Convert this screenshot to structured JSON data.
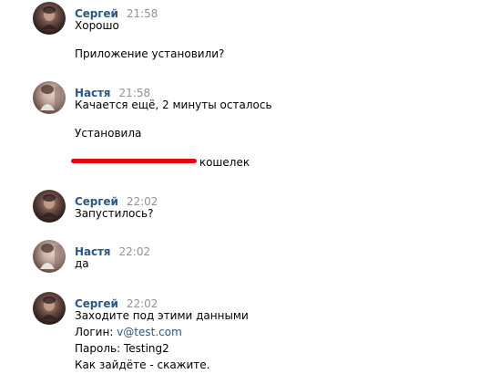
{
  "messages": [
    {
      "author": "Сергей",
      "time": "21:58",
      "lines": [
        "Хорошо",
        "",
        "Приложение установили?"
      ]
    },
    {
      "author": "Настя",
      "time": "21:58",
      "lines": [
        "Качается ещё, 2 минуты осталось",
        "",
        "Установила",
        "",
        "кошелек"
      ]
    },
    {
      "author": "Сергей",
      "time": "22:02",
      "lines": [
        "Запустилось?"
      ]
    },
    {
      "author": "Настя",
      "time": "22:02",
      "lines": [
        "да"
      ]
    },
    {
      "author": "Сергей",
      "time": "22:02",
      "lines": [
        "Заходите под этими данными",
        "Логин: ",
        "v@test.com",
        "Пароль: Testing2",
        "Как зайдёте - скажите."
      ]
    }
  ],
  "colors": {
    "author": "#2a5885",
    "time": "#939393",
    "redaction": "#e30613",
    "link": "#2a5885"
  },
  "icons": {
    "sergey_avatar": "avatar-photo-male",
    "nastya_avatar": "avatar-photo-female"
  }
}
